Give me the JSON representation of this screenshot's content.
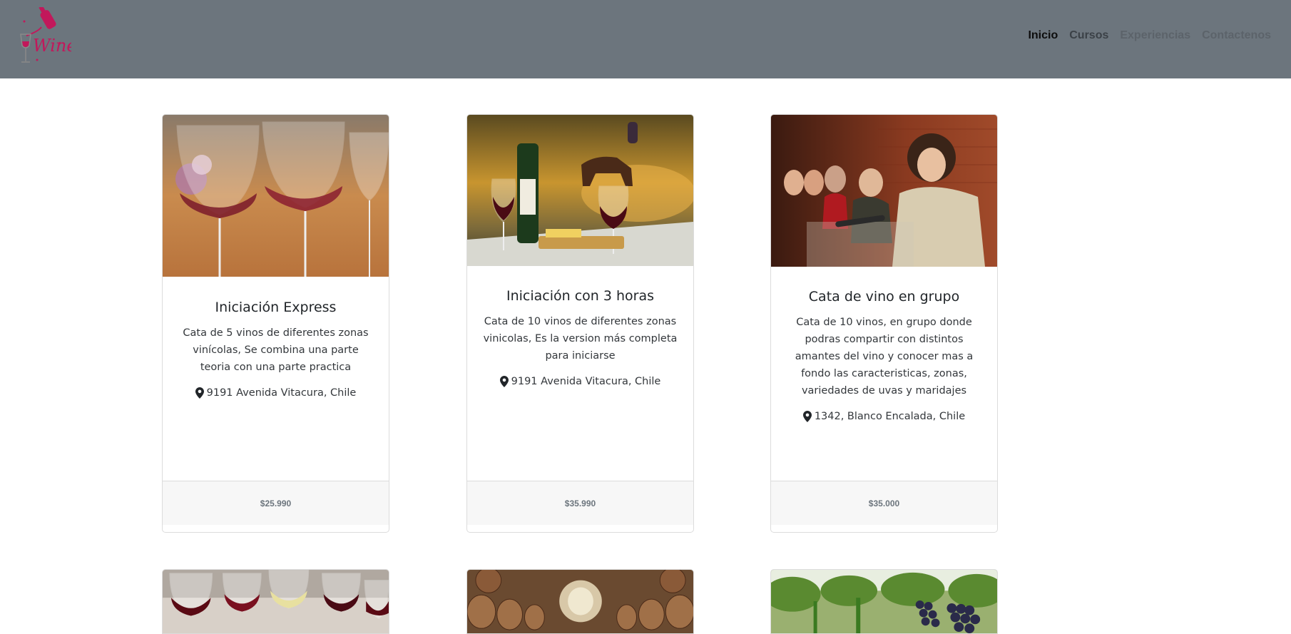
{
  "brand": {
    "logo_text": "Wine"
  },
  "nav": {
    "items": [
      {
        "label": "Inicio"
      },
      {
        "label": "Cursos"
      },
      {
        "label": "Experiencias"
      },
      {
        "label": "Contactenos"
      }
    ]
  },
  "cards": [
    {
      "title": "Iniciación Express",
      "description": "Cata de 5 vinos de diferentes zonas vinícolas, Se combina una parte teoria con una parte practica",
      "location": "9191 Avenida Vitacura, Chile",
      "price": "$25.990"
    },
    {
      "title": "Iniciación con 3 horas",
      "description": "Cata de 10 vinos de diferentes zonas vinicolas, Es la version más completa para iniciarse",
      "location": "9191 Avenida Vitacura, Chile",
      "price": "$35.990"
    },
    {
      "title": "Cata de vino en grupo",
      "description": "Cata de 10 vinos, en grupo donde podras compartir con distintos amantes del vino y conocer mas a fondo las caracteristicas, zonas, variedades de uvas y maridajes",
      "location": "1342, Blanco Encalada, Chile",
      "price": "$35.000"
    }
  ],
  "colors": {
    "navbar": "#6c757d",
    "brand_pink": "#c2185b",
    "footer_bg": "#f7f7f7",
    "price_text": "#6c757d"
  }
}
